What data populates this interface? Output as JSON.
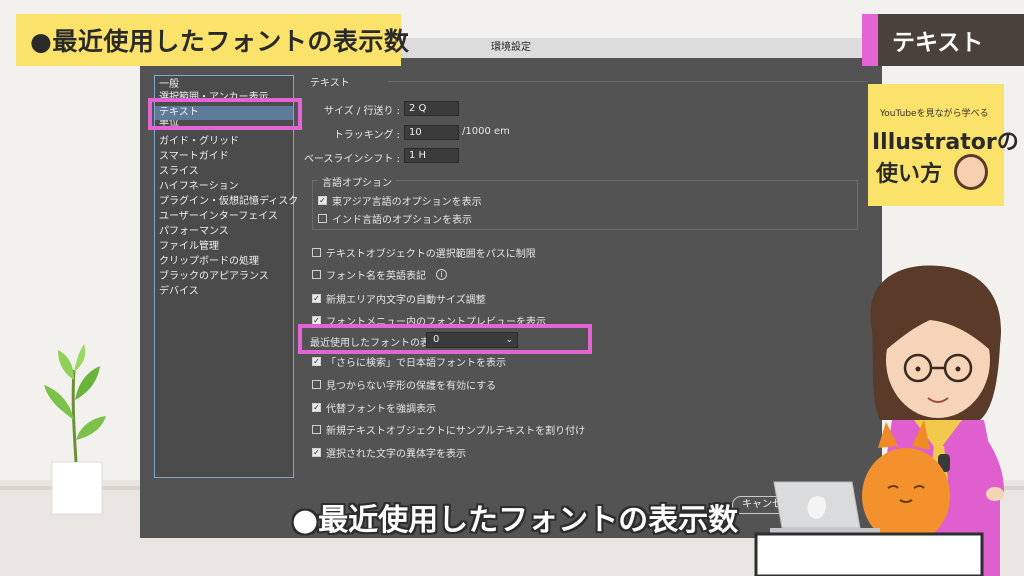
{
  "banner": {
    "title": "●最近使用したフォントの表示数"
  },
  "category_banner": {
    "label": "テキスト"
  },
  "channel_card": {
    "subtitle": "YouTubeを見ながら学べる",
    "line1": "Illustratorの",
    "line2": "使い方"
  },
  "dialog": {
    "window_title": "環境設定",
    "sidebar_items": [
      "一般",
      "選択範囲・アンカー表示",
      "テキスト",
      "単位",
      "ガイド・グリッド",
      "スマートガイド",
      "スライス",
      "ハイフネーション",
      "プラグイン・仮想記憶ディスク",
      "ユーザーインターフェイス",
      "パフォーマンス",
      "ファイル管理",
      "クリップボードの処理",
      "ブラックのアピアランス",
      "デバイス"
    ],
    "selected_item_index": 2,
    "section_title": "テキスト",
    "size_leading": {
      "label": "サイズ / 行送り :",
      "value": "2 Q"
    },
    "tracking": {
      "label": "トラッキング :",
      "value": "10",
      "unit": "/1000 em"
    },
    "baseline_shift": {
      "label": "ベースラインシフト :",
      "value": "1 H"
    },
    "language_options": {
      "title": "言語オプション",
      "items": [
        {
          "label": "東アジア言語のオプションを表示",
          "checked": true
        },
        {
          "label": "インド言語のオプションを表示",
          "checked": false
        }
      ]
    },
    "options_a": [
      {
        "label": "テキストオブジェクトの選択範囲をパスに制限",
        "checked": false
      },
      {
        "label": "フォント名を英語表記",
        "checked": false
      },
      {
        "label": "新規エリア内文字の自動サイズ調整",
        "checked": true
      },
      {
        "label": "フォントメニュー内のフォントプレビューを表示",
        "checked": true
      }
    ],
    "recent_fonts": {
      "label": "最近使用したフォントの表示数 :",
      "value": "0"
    },
    "options_b": [
      {
        "label": "「さらに検索」で日本語フォントを表示",
        "checked": true
      },
      {
        "label": "見つからない字形の保護を有効にする",
        "checked": false
      },
      {
        "label": "代替フォントを強調表示",
        "checked": true
      },
      {
        "label": "新規テキストオブジェクトにサンプルテキストを割り付け",
        "checked": false
      },
      {
        "label": "選択された文字の異体字を表示",
        "checked": true
      }
    ],
    "cancel_label": "キャンセル",
    "info_icon_glyph": "i"
  },
  "caption": {
    "text": "●最近使用したフォントの表示数"
  },
  "colors": {
    "highlight": "#e364d4",
    "banner_yellow": "#fbe26a",
    "dialog_bg": "#535353",
    "selection_blue": "#5d7a9a"
  }
}
